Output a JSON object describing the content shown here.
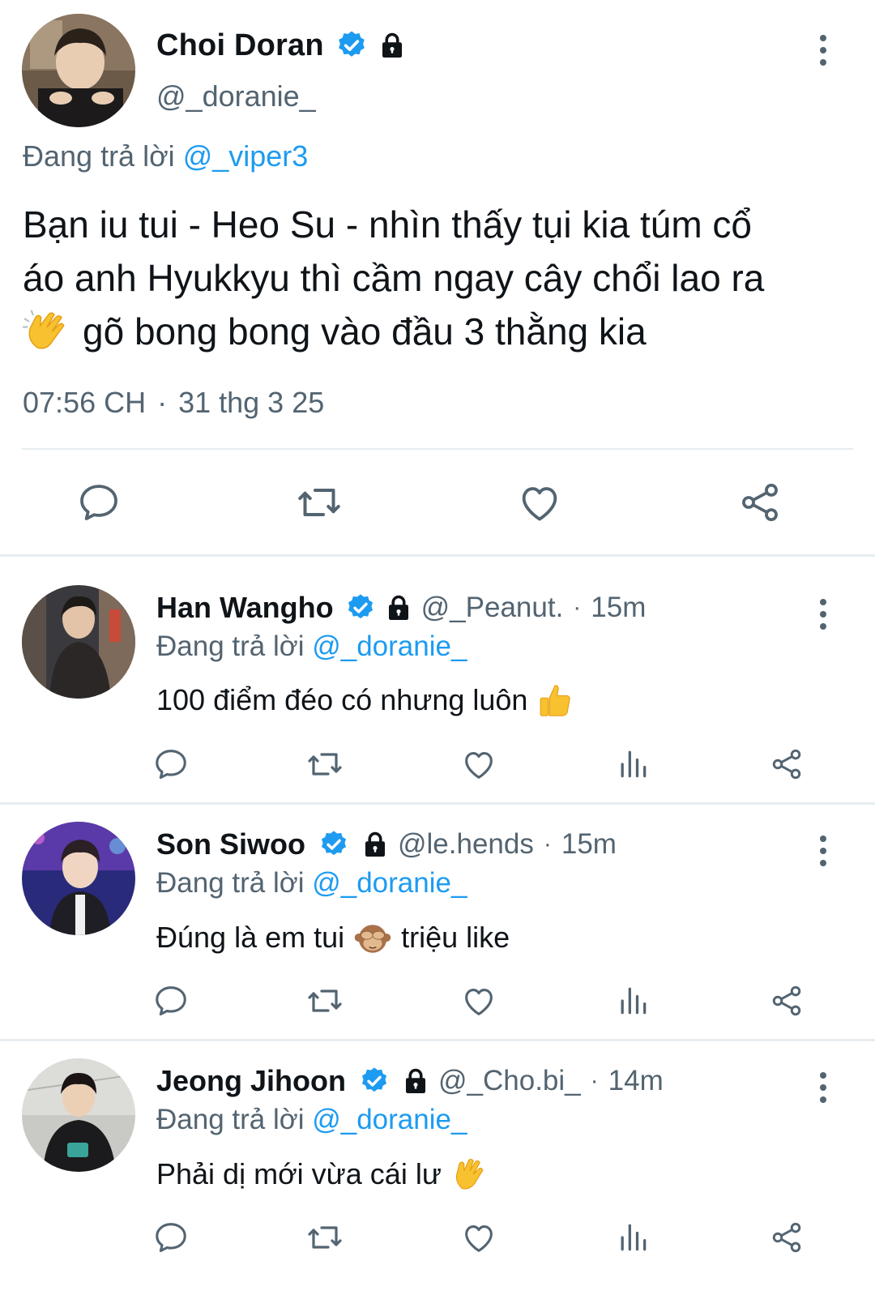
{
  "main_tweet": {
    "author_name": "Choi Doran",
    "author_handle": "@_doranie_",
    "replying_prefix": "Đang trả lời",
    "replying_to": "@_viper3",
    "text_line1": "Bạn iu tui - Heo Su - nhìn thấy tụi kia túm cổ",
    "text_line2": "áo anh Hyukkyu thì cầm ngay cây chổi lao ra",
    "text_line3": "gõ bong bong vào đầu 3 thằng kia",
    "text_emoji": "clapping-hands",
    "time": "07:56 CH",
    "date": "31 thg 3 25",
    "actions": [
      "reply-icon",
      "retweet-icon",
      "like-icon",
      "share-icon"
    ]
  },
  "replies": [
    {
      "name": "Han Wangho",
      "handle": "@_Peanut.",
      "time": "15m",
      "replying_prefix": "Đang trả lời",
      "replying_to": "@_doranie_",
      "text": "100 điểm đéo có nhưng luôn",
      "emoji": "thumbs-up"
    },
    {
      "name": "Son Siwoo",
      "handle": "@le.hends",
      "time": "15m",
      "replying_prefix": "Đang trả lời",
      "replying_to": "@_doranie_",
      "text_before": "Đúng là em tui",
      "text_after": "triệu like",
      "emoji": "see-no-evil-monkey"
    },
    {
      "name": "Jeong Jihoon",
      "handle": "@_Cho.bi_",
      "time": "14m",
      "replying_prefix": "Đang trả lời",
      "replying_to": "@_doranie_",
      "text": "Phải dị mới vừa cái lư",
      "emoji": "waving-hand"
    }
  ],
  "reply_actions": [
    "reply-icon",
    "retweet-icon",
    "like-icon",
    "views-icon",
    "share-icon"
  ],
  "colors": {
    "text": "#0f1419",
    "secondary": "#536471",
    "accent": "#1d9bf0",
    "divider": "#e6ecf0"
  }
}
